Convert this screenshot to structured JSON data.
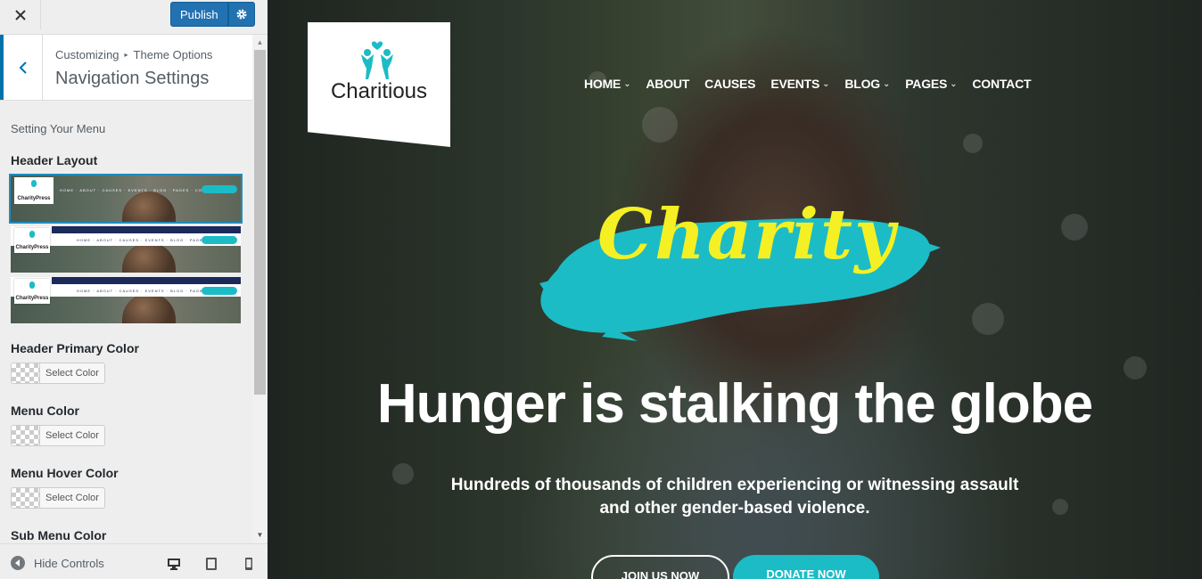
{
  "topbar": {
    "close_icon": "close-icon",
    "publish_label": "Publish",
    "settings_icon": "gear-icon"
  },
  "section": {
    "breadcrumb": [
      "Customizing",
      "Theme Options"
    ],
    "title": "Navigation Settings"
  },
  "panel": {
    "setting_label": "Setting Your Menu",
    "header_layout_label": "Header Layout",
    "layouts": [
      {
        "logo": "CharityPress",
        "nav": "HOME · ABOUT · CAUSES · EVENTS · BLOG · PAGES · CONTACT",
        "selected": true
      },
      {
        "logo": "CharityPress",
        "nav": "HOME · ABOUT · CAUSES · EVENTS · BLOG · PAGES · CONTACT",
        "selected": false
      },
      {
        "logo": "CharityPress",
        "nav": "HOME · ABOUT · CAUSES · EVENTS · BLOG · PAGES · CONTACT",
        "selected": false
      }
    ],
    "color_controls": [
      {
        "label": "Header Primary Color",
        "button": "Select Color"
      },
      {
        "label": "Menu Color",
        "button": "Select Color"
      },
      {
        "label": "Menu Hover Color",
        "button": "Select Color"
      },
      {
        "label": "Sub Menu Color"
      }
    ]
  },
  "footer": {
    "hide_controls": "Hide Controls",
    "devices": [
      "desktop-icon",
      "tablet-icon",
      "mobile-icon"
    ]
  },
  "preview": {
    "logo_text": "Charitious",
    "nav": [
      {
        "label": "HOME",
        "dropdown": true
      },
      {
        "label": "ABOUT",
        "dropdown": false
      },
      {
        "label": "CAUSES",
        "dropdown": false
      },
      {
        "label": "EVENTS",
        "dropdown": true
      },
      {
        "label": "BLOG",
        "dropdown": true
      },
      {
        "label": "PAGES",
        "dropdown": true
      },
      {
        "label": "CONTACT",
        "dropdown": false
      }
    ],
    "script_word": "Charity",
    "hero_title": "Hunger is stalking the globe",
    "hero_sub_line1": "Hundreds of thousands of children experiencing or witnessing assault",
    "hero_sub_line2": "and other gender-based violence.",
    "join_label": "JOIN US NOW",
    "donate_label": "DONATE NOW"
  },
  "colors": {
    "accent": "#1bbcc6",
    "wp_blue": "#2271b1",
    "script_yellow": "#f4f024"
  }
}
